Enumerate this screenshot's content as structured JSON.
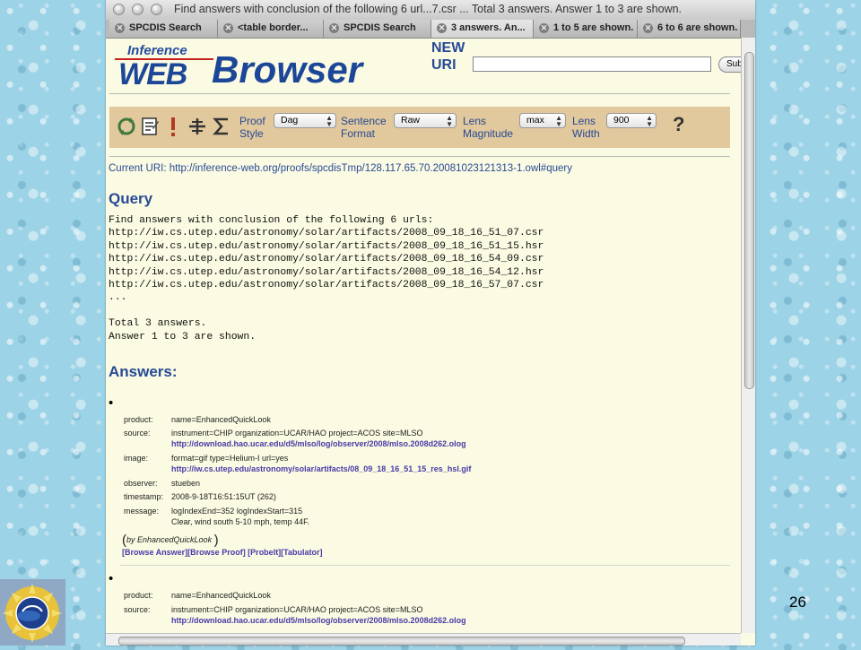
{
  "window": {
    "title": "Find answers with conclusion of the following 6 url...7.csr ... Total 3 answers. Answer 1 to 3 are shown."
  },
  "tabs": [
    {
      "label": "SPCDIS Search"
    },
    {
      "label": "<table border..."
    },
    {
      "label": "SPCDIS Search"
    },
    {
      "label": "3 answers. An..."
    },
    {
      "label": "1 to 5 are shown."
    },
    {
      "label": "6 to 6 are shown."
    }
  ],
  "logo": {
    "inference": "Inference",
    "web": "WEB",
    "browser": "Browser"
  },
  "new_uri": {
    "line1": "NEW",
    "line2": "URI",
    "input_value": "",
    "submit_label": "Sub"
  },
  "toolbar": {
    "proof_style": {
      "label1": "Proof",
      "label2": "Style",
      "value": "Dag"
    },
    "sentence_format": {
      "label1": "Sentence",
      "label2": "Format",
      "value": "Raw"
    },
    "lens_magnitude": {
      "label1": "Lens",
      "label2": "Magnitude",
      "value": "max"
    },
    "lens_width": {
      "label1": "Lens",
      "label2": "Width",
      "value": "900"
    },
    "icons": [
      "refresh-icon",
      "notes-icon",
      "exclamation-icon",
      "split-icon",
      "sigma-icon",
      "help-icon"
    ]
  },
  "current_uri": "Current URI: http://inference-web.org/proofs/spcdisTmp/128.117.65.70.20081023121313-1.owl#query",
  "query": {
    "heading": "Query",
    "lines": [
      "Find answers with conclusion of the following 6 urls:",
      "http://iw.cs.utep.edu/astronomy/solar/artifacts/2008_09_18_16_51_07.csr",
      "http://iw.cs.utep.edu/astronomy/solar/artifacts/2008_09_18_16_51_15.hsr",
      "http://iw.cs.utep.edu/astronomy/solar/artifacts/2008_09_18_16_54_09.csr",
      "http://iw.cs.utep.edu/astronomy/solar/artifacts/2008_09_18_16_54_12.hsr",
      "http://iw.cs.utep.edu/astronomy/solar/artifacts/2008_09_18_16_57_07.csr",
      "...",
      "",
      "Total 3 answers.",
      "Answer 1 to 3 are shown."
    ]
  },
  "answers": {
    "heading": "Answers:",
    "items": [
      {
        "product_key": "product:",
        "product": "name=EnhancedQuickLook",
        "source_key": "source:",
        "source": "instrument=CHIP organization=UCAR/HAO project=ACOS site=MLSO",
        "source_link": "http://download.hao.ucar.edu/d5/mlso/log/observer/2008/mlso.2008d262.olog",
        "image_key": "image:",
        "image": "format=gif type=Helium-I url=yes",
        "image_link": "http://iw.cs.utep.edu/astronomy/solar/artifacts/08_09_18_16_51_15_res_hsl.gif",
        "observer_key": "observer:",
        "observer": "stueben",
        "timestamp_key": "timestamp:",
        "timestamp": "2008-9-18T16:51:15UT (262)",
        "message_key": "message:",
        "message1": "logIndexEnd=352 logIndexStart=315",
        "message2": "Clear, wind south 5-10 mph, temp 44F.",
        "by": "by EnhancedQuickLook",
        "links": "[Browse Answer][Browse Proof] [ProbeIt][Tabulator]"
      },
      {
        "product_key": "product:",
        "product": "name=EnhancedQuickLook",
        "source_key": "source:",
        "source": "instrument=CHIP organization=UCAR/HAO project=ACOS site=MLSO",
        "source_link": "http://download.hao.ucar.edu/d5/mlso/log/observer/2008/mlso.2008d262.olog"
      }
    ]
  },
  "slide": {
    "page_number": "26"
  }
}
